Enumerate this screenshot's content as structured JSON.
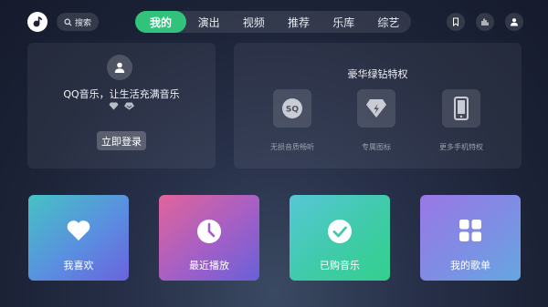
{
  "header": {
    "logo_icon": "qq-music-logo-icon",
    "search_label": "搜索",
    "tabs": [
      {
        "label": "我的",
        "active": true
      },
      {
        "label": "演出",
        "active": false
      },
      {
        "label": "视频",
        "active": false
      },
      {
        "label": "推荐",
        "active": false
      },
      {
        "label": "乐库",
        "active": false
      },
      {
        "label": "综艺",
        "active": false
      }
    ],
    "right_icons": [
      "bookmark-icon",
      "equalizer-icon",
      "user-icon"
    ],
    "accent_color": "#31c27c"
  },
  "login_panel": {
    "avatar_icon": "user-avatar-icon",
    "slogan": "QQ音乐，让生活充满音乐",
    "badge_icons": [
      "diamond-icon",
      "vip-badge-icon"
    ],
    "login_button": "立即登录"
  },
  "vip_panel": {
    "title": "豪华绿钻特权",
    "perks": [
      {
        "icon": "sq-icon",
        "label": "无损音质畅听"
      },
      {
        "icon": "diamond-badge-icon",
        "label": "专属图标"
      },
      {
        "icon": "phone-icon",
        "label": "更多手机特权"
      }
    ]
  },
  "cards": [
    {
      "icon": "heart-icon",
      "label": "我喜欢",
      "colors": [
        "#45c2c4",
        "#6a63de"
      ]
    },
    {
      "icon": "clock-icon",
      "label": "最近播放",
      "colors": [
        "#e1649b",
        "#6860d9"
      ]
    },
    {
      "icon": "check-circle-icon",
      "label": "已购音乐",
      "colors": [
        "#57c7d6",
        "#34cf8e"
      ]
    },
    {
      "icon": "grid-icon",
      "label": "我的歌单",
      "colors": [
        "#9a77e6",
        "#65a7e0"
      ]
    }
  ]
}
